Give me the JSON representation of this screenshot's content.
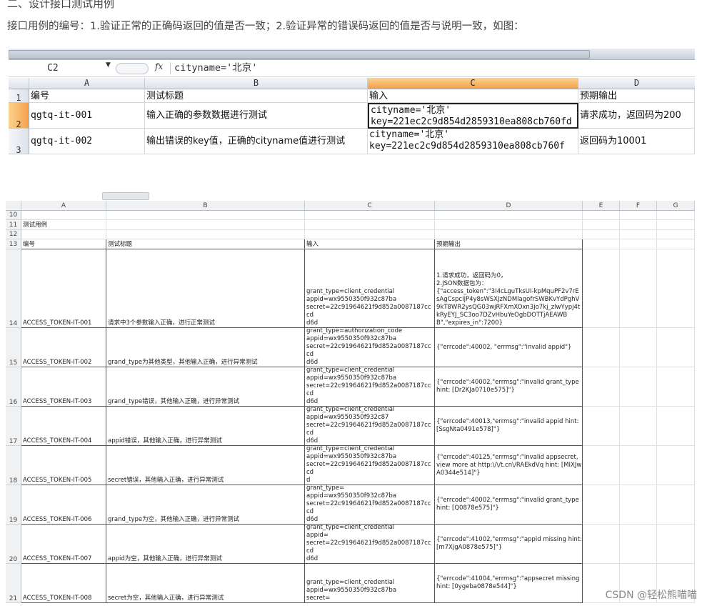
{
  "article": {
    "heading": "二、设计接口测试用例",
    "intro": "接口用例的编号：1.验证正常的正确码返回的值是否一致；2.验证异常的错误码返回的值是否与说明一致，如图："
  },
  "excel1": {
    "name_box": "C2",
    "fx_label": "fx",
    "formula_value": "cityname='北京'",
    "col_headers": [
      "A",
      "B",
      "C",
      "D"
    ],
    "row_headers": [
      "1",
      "2",
      "3"
    ],
    "rows": [
      {
        "a": "编号",
        "b": "测试标题",
        "c": "输入",
        "d": "预期输出"
      },
      {
        "a": "qgtq-it-001",
        "b": "输入正确的参数数据进行测试",
        "c1": "cityname='北京'",
        "c2": "key=221ec2c9d854d2859310ea808cb760fd",
        "d": "请求成功，返回码为200"
      },
      {
        "a": "qgtq-it-002",
        "b": "输出错误的key值，正确的cityname值进行测试",
        "c1": "cityname='北京'",
        "c2": "key=221ec2c9d854d2859310ea808cb760f",
        "d": "返回码为10001"
      }
    ]
  },
  "excel2": {
    "col_headers": [
      "A",
      "B",
      "C",
      "D",
      "E",
      "F",
      "G"
    ],
    "row_headers": [
      "10",
      "11",
      "12",
      "13",
      "14",
      "15",
      "16",
      "17",
      "18",
      "19",
      "20",
      "21"
    ],
    "section_title": "测试用例",
    "table_header": {
      "a": "编号",
      "b": "测试标题",
      "c": "输入",
      "d": "预期输出"
    },
    "rows": [
      {
        "a": "ACCESS_TOKEN-IT-001",
        "b": "请求中3个参数输入正确，进行正常测试",
        "c": "grant_type=client_credential\nappid=wx9550350f932c87ba\nsecret=22c91964621f9d852a0087187cccd\nd6d",
        "d": "1.请求成功，返回码为0，\n2.JSON数据包为：\n{\"access_token\":\"3I4cLguTksUI-kpMquPF2v7rEsAgCspcIjP4y8sWSXJzNDMlagofrSWBKvYdPghV9kT8WR2ysQG03wjRFXmXOxn3jo7kj_zlwYypj4tkRyEYJ_SC3oo7DZvHbuYeOgbDOTTjAEAWBB\",\"expires_in\":7200}"
      },
      {
        "a": "ACCESS_TOKEN-IT-002",
        "b": "grand_type为其他类型，其他输入正确，进行异常测试",
        "c": "grant_type=authorization_code\nappid=wx9550350f932c87ba\nsecret=22c91964621f9d852a0087187cccd\nd6d",
        "d": "{\"errcode\":40002, \"errmsg\":\"invalid appid\"}"
      },
      {
        "a": "ACCESS_TOKEN-IT-003",
        "b": "grand_type错误，其他输入正确，进行异常测试",
        "c": "grant_type=client_credential\nappid=wx9550350f932c87ba\nsecret=22c91964621f9d852a0087187cccd\nd6d",
        "d": "{\"errcode\":40002,\"errmsg\":\"invalid grant_type hint: [Dr2KJa0710e575]\"}"
      },
      {
        "a": "ACCESS_TOKEN-IT-004",
        "b": "appid错误，其他输入正确，进行异常测试",
        "c": "grant_type=client_credential\nappid=wx9550350f932c87\nsecret=22c91964621f9d852a0087187cccd\nd6d",
        "d": "{\"errcode\":40013,\"errmsg\":\"invalid appid hint: [SsgNta0491e578]\"}"
      },
      {
        "a": "ACCESS_TOKEN-IT-005",
        "b": "secret错误，其他输入正确，进行异常测试",
        "c": "grant_type=client_credential\nappid=wx9550350f932c87ba\nsecret=22c91964621f9d852a0087187cccd\nd",
        "d": "{\"errcode\":40125,\"errmsg\":\"invalid appsecret, view more at http:\\/\\/t.cn\\/RAEkdVq hint: [MIXJwA0344e514]\"}"
      },
      {
        "a": "ACCESS_TOKEN-IT-006",
        "b": "grand_type为空，其他输入正确，进行异常测试",
        "c": "grant_type=\nappid=wx9550350f932c87ba\nsecret=22c91964621f9d852a0087187cccd\nd6d",
        "d": "{\"errcode\":40002,\"errmsg\":\"invalid grant_type hint: [Q0878e575]\"}"
      },
      {
        "a": "ACCESS_TOKEN-IT-007",
        "b": "appid为空，其他输入正确，进行异常测试",
        "c": "grant_type=client_credential\nappid=\nsecret=22c91964621f9d852a0087187cccd\nd6d",
        "d": "{\"errcode\":41002,\"errmsg\":\"appid missing hint: [m7XjgA0878e575]\"}"
      },
      {
        "a": "ACCESS_TOKEN-IT-008",
        "b": "secret为空，其他输入正确，进行异常测试",
        "c": "grant_type=client_credential\nappid=wx9550350f932c87ba\nsecret=",
        "d": "{\"errcode\":41004,\"errmsg\":\"appsecret missing hint: [0ygeba0878e544]\"}"
      }
    ]
  },
  "watermark": "CSDN @轻松熊喵喵"
}
